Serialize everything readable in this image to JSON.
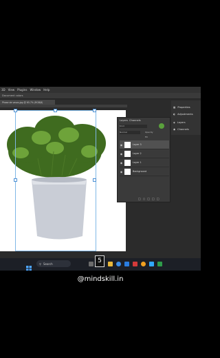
{
  "menu": {
    "items": [
      "3D",
      "View",
      "Plugins",
      "Window",
      "Help"
    ]
  },
  "options": {
    "text": "Document colors"
  },
  "document_tab": {
    "title": "Phase de vasos.jpg @ 65.7% (RGB/8)"
  },
  "layers_panel": {
    "tabs": [
      "Layers",
      "Channels"
    ],
    "filter_label": "Kind",
    "blend_mode": "Normal",
    "opacity_label": "Opacity",
    "fill_label": "Fill",
    "layers": [
      {
        "name": "Layer 3",
        "active": true
      },
      {
        "name": "Layer 2",
        "active": false
      },
      {
        "name": "Layer 1",
        "active": false
      },
      {
        "name": "Background",
        "active": false
      }
    ]
  },
  "right_panel": {
    "items": [
      "Properties",
      "Adjustments",
      "Layers",
      "Channels"
    ]
  },
  "taskbar": {
    "search_label": "Search",
    "badge": "5"
  },
  "watermark": "@mindskill.in",
  "colors": {
    "accent_green": "#5aa03c",
    "selection": "#7fb7e6",
    "taskbar": "#1c1f26"
  }
}
